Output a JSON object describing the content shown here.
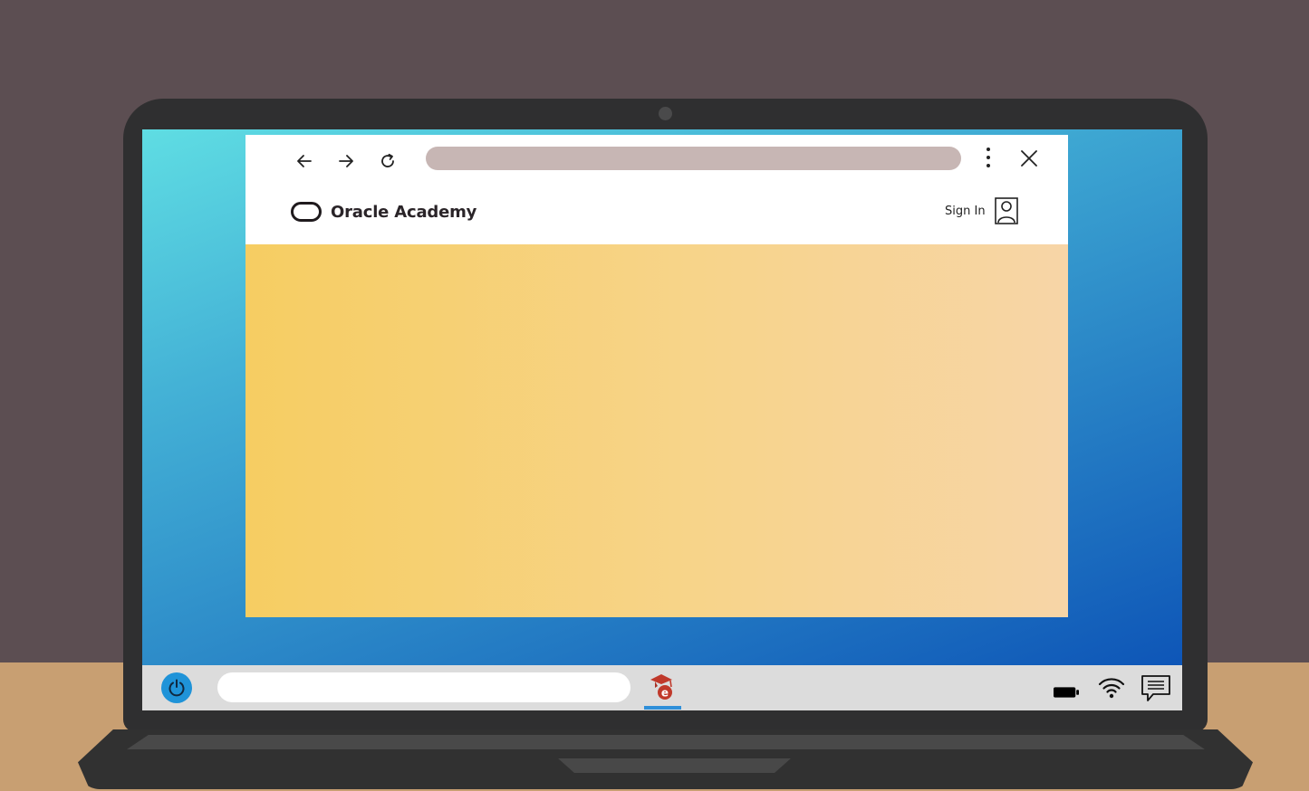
{
  "browser": {
    "back_icon": "arrow-left-icon",
    "forward_icon": "arrow-right-icon",
    "reload_icon": "reload-icon",
    "menu_icon": "vertical-dots-icon",
    "close_icon": "close-icon",
    "address_bar_value": ""
  },
  "site": {
    "brand_name": "Oracle Academy",
    "logo_icon": "oracle-logo-icon",
    "sign_in_label": "Sign In",
    "user_icon": "user-icon"
  },
  "taskbar": {
    "power_icon": "power-icon",
    "search_value": "",
    "app_icon": "oracle-academy-app-icon",
    "battery_icon": "battery-icon",
    "wifi_icon": "wifi-icon",
    "notifications_icon": "chat-icon"
  },
  "colors": {
    "screen_gradient_start": "#5fdde3",
    "screen_gradient_end": "#0a4fb5",
    "hero_gradient_start": "#f6cd62",
    "hero_gradient_end": "#f7d5a7",
    "address_bar": "#c7b6b4",
    "taskbar": "#dcdcdc",
    "power_button": "#1f93d8",
    "app_icon": "#c0392b",
    "active_app_indicator": "#2f8fd9"
  }
}
